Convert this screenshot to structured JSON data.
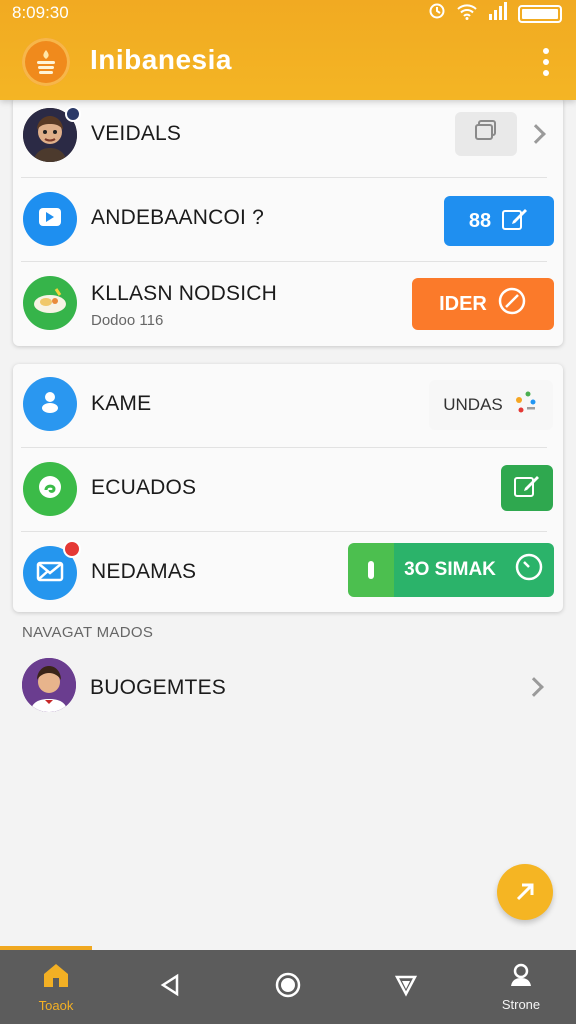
{
  "status_bar": {
    "time": "8:09:30"
  },
  "app_bar": {
    "title": "Inibanesia"
  },
  "card1": {
    "rows": [
      {
        "label": "VEIDALS"
      },
      {
        "label": "ANDEBAANCOI ?",
        "action_label": "88"
      },
      {
        "label": "KLLASN NODSICH",
        "sublabel": "Dodoo 116",
        "action_label": "IDER"
      }
    ]
  },
  "card2": {
    "rows": [
      {
        "label": "KAME",
        "chip_label": "UNDAS"
      },
      {
        "label": "ECUADOS"
      },
      {
        "label": "NEDAMAS",
        "action_label": "3O SIMAK"
      }
    ]
  },
  "section": {
    "title": "NAVAGAT MADOS"
  },
  "list": {
    "item_label": "BUOGEMTES"
  },
  "bottom_nav": {
    "home_label": "Toaok",
    "profile_label": "Strone"
  },
  "colors": {
    "accent": "#f3b024",
    "blue": "#2196f3",
    "orange": "#fb7a2a",
    "green": "#3dbb56",
    "nav_bar": "#5c5c5c"
  },
  "icons": [
    "battery-icon",
    "signal-icon",
    "wifi-icon",
    "alarm-icon",
    "app-logo-icon",
    "more-vert-icon",
    "stack-icon",
    "chevron-right-icon",
    "send-icon",
    "edit-icon",
    "cancel-icon",
    "food-icon",
    "person-icon",
    "dots-icon",
    "swirl-icon",
    "mail-icon",
    "timer-icon",
    "home-icon",
    "back-icon",
    "circle-home-icon",
    "recents-icon",
    "profile-icon"
  ]
}
